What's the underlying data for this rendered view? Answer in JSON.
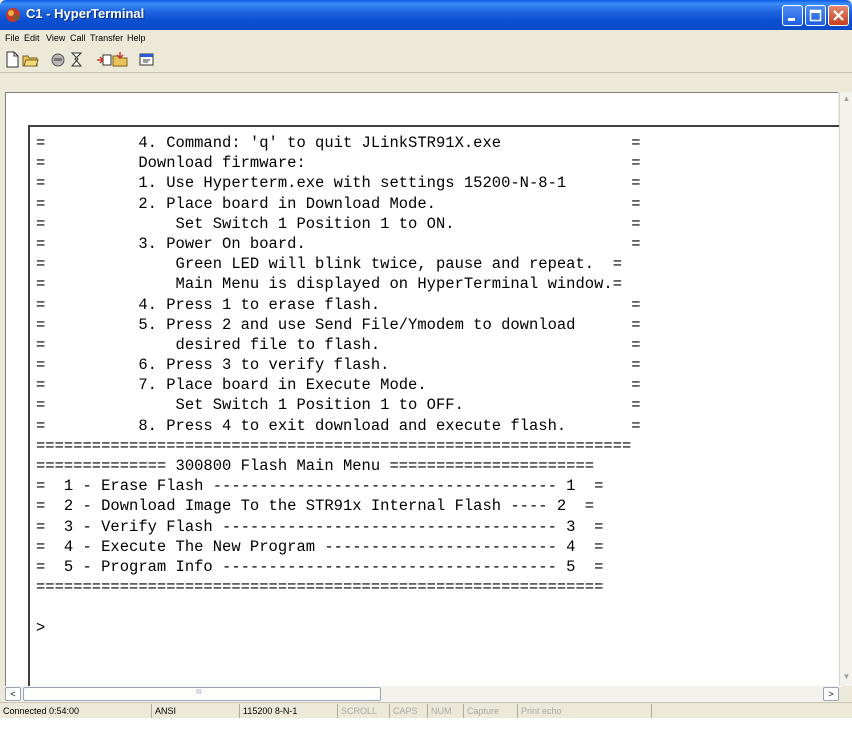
{
  "window": {
    "title": "C1 - HyperTerminal"
  },
  "menubar": {
    "items": [
      "File",
      "Edit",
      "View",
      "Call",
      "Transfer",
      "Help"
    ]
  },
  "toolbar": {
    "icons": [
      "new-connection-icon",
      "open-icon",
      "disconnect-icon",
      "dial-icon",
      "send-icon",
      "receive-icon",
      "properties-icon"
    ]
  },
  "terminal": {
    "lines": [
      "=          4. Command: 'q' to quit JLinkSTR91X.exe              =",
      "=          Download firmware:                                   =",
      "=          1. Use Hyperterm.exe with settings 15200-N-8-1       =",
      "=          2. Place board in Download Mode.                     =",
      "=              Set Switch 1 Position 1 to ON.                   =",
      "=          3. Power On board.                                   =",
      "=              Green LED will blink twice, pause and repeat.  =",
      "=              Main Menu is displayed on HyperTerminal window.=",
      "=          4. Press 1 to erase flash.                           =",
      "=          5. Press 2 and use Send File/Ymodem to download      =",
      "=              desired file to flash.                           =",
      "=          6. Press 3 to verify flash.                          =",
      "=          7. Place board in Execute Mode.                      =",
      "=              Set Switch 1 Position 1 to OFF.                  =",
      "=          8. Press 4 to exit download and execute flash.       =",
      "================================================================",
      "============== 300800 Flash Main Menu ======================",
      "=  1 - Erase Flash ------------------------------------- 1  =",
      "=  2 - Download Image To the STR91x Internal Flash ---- 2  =",
      "=  3 - Verify Flash ------------------------------------ 3  =",
      "=  4 - Execute The New Program ------------------------- 4  =",
      "=  5 - Program Info ------------------------------------ 5  =",
      "=============================================================",
      "",
      ">"
    ]
  },
  "scrollbar": {
    "grip": "III",
    "left_arrow": "<",
    "right_arrow": ">"
  },
  "statusbar": {
    "connected": "Connected 0:54:00",
    "emulation": "ANSI",
    "settings": "115200 8-N-1",
    "scroll": "SCROLL",
    "caps": "CAPS",
    "num": "NUM",
    "capture": "Capture",
    "print_echo": "Print echo"
  },
  "colors": {
    "titlebar": "#0a5ce8",
    "chrome": "#ece9d8",
    "terminal_bg": "#ffffff",
    "terminal_text": "#000000"
  }
}
